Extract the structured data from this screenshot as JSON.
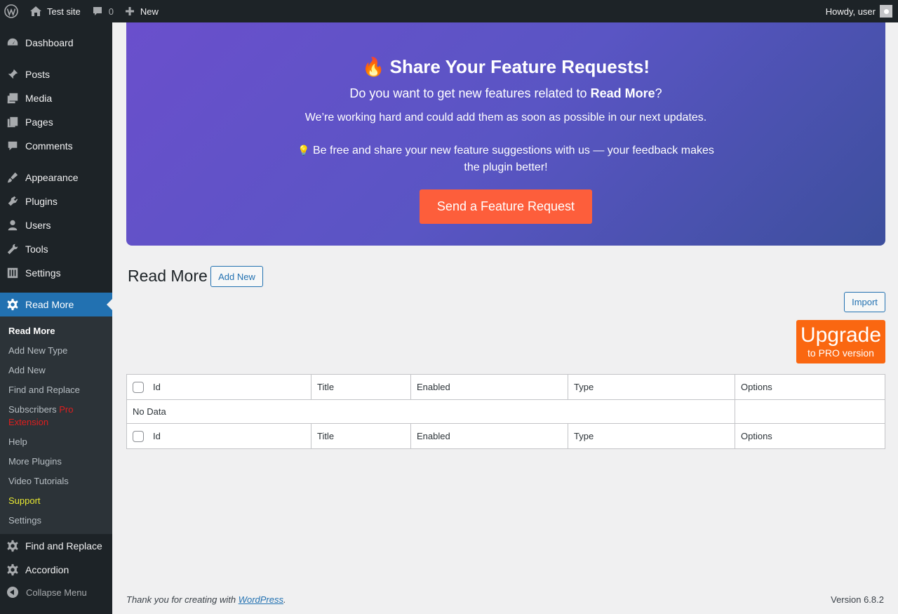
{
  "adminbar": {
    "site_name": "Test site",
    "comments_count": "0",
    "new_label": "New",
    "howdy": "Howdy, user"
  },
  "sidebar": {
    "menu": [
      {
        "label": "Dashboard",
        "icon": "dashboard-icon"
      },
      {
        "label": "Posts",
        "icon": "pin-icon"
      },
      {
        "label": "Media",
        "icon": "media-icon"
      },
      {
        "label": "Pages",
        "icon": "pages-icon"
      },
      {
        "label": "Comments",
        "icon": "comment-icon"
      },
      {
        "label": "Appearance",
        "icon": "brush-icon"
      },
      {
        "label": "Plugins",
        "icon": "plug-icon"
      },
      {
        "label": "Users",
        "icon": "user-icon"
      },
      {
        "label": "Tools",
        "icon": "wrench-icon"
      },
      {
        "label": "Settings",
        "icon": "settings-sliders-icon"
      },
      {
        "label": "Read More",
        "icon": "gear-icon"
      },
      {
        "label": "Find and Replace",
        "icon": "gear-icon"
      },
      {
        "label": "Accordion",
        "icon": "gear-icon"
      }
    ],
    "submenu": [
      {
        "label": "Read More"
      },
      {
        "label": "Add New Type"
      },
      {
        "label": "Add New"
      },
      {
        "label": "Find and Replace"
      },
      {
        "label": "Subscribers",
        "suffix": "Pro Extension"
      },
      {
        "label": "Help"
      },
      {
        "label": "More Plugins"
      },
      {
        "label": "Video Tutorials"
      },
      {
        "label": "Support"
      },
      {
        "label": "Settings"
      }
    ],
    "collapse_label": "Collapse Menu"
  },
  "banner": {
    "emoji": "🔥",
    "title": "Share Your Feature Requests!",
    "subtitle_prefix": "Do you want to get new features related to ",
    "subtitle_bold": "Read More",
    "subtitle_suffix": "?",
    "line": "We’re working hard and could add them as soon as possible in our next updates.",
    "para_emoji": "💡",
    "para": "Be free and share your new feature suggestions with us — your feedback makes the plugin better!",
    "button": "Send a Feature Request"
  },
  "page": {
    "title": "Read More",
    "add_new": "Add New",
    "import": "Import",
    "upgrade_main": "Upgrade",
    "upgrade_sub": "to PRO version"
  },
  "table": {
    "columns": [
      "Id",
      "Title",
      "Enabled",
      "Type",
      "Options"
    ],
    "empty": "No Data"
  },
  "footer": {
    "thanks_prefix": "Thank you for creating with ",
    "thanks_link": "WordPress",
    "thanks_suffix": ".",
    "version": "Version 6.8.2"
  },
  "colors": {
    "accent": "#2271b1",
    "sidebar_bg": "#1d2327",
    "banner_button": "#fd5e3b",
    "upgrade": "#fa6711"
  }
}
